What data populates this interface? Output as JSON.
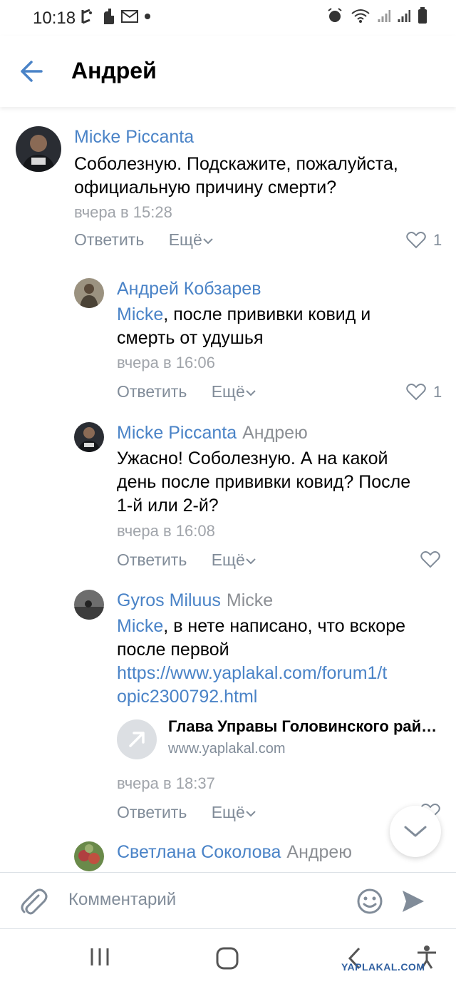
{
  "status_bar": {
    "time": "10:18"
  },
  "header": {
    "title": "Андрей"
  },
  "comments": [
    {
      "author": "Micke Piccanta",
      "reply_to": "",
      "mention": "",
      "text": "Соболезную. Подскажите, пожалуйста, официальную причину смерти?",
      "time": "вчера в 15:28",
      "reply_label": "Ответить",
      "more_label": "Ещё",
      "likes": "1"
    },
    {
      "author": "Андрей Кобзарев",
      "reply_to": "",
      "mention": "Micke",
      "text": ", после прививки ковид и смерть от удушья",
      "time": "вчера в 16:06",
      "reply_label": "Ответить",
      "more_label": "Ещё",
      "likes": "1"
    },
    {
      "author": "Micke Piccanta",
      "reply_to": "Андрею",
      "mention": "",
      "text": "Ужасно! Соболезную. А на какой день после прививки ковид? После 1-й или 2-й?",
      "time": "вчера в 16:08",
      "reply_label": "Ответить",
      "more_label": "Ещё",
      "likes": ""
    },
    {
      "author": "Gyros Miluus",
      "reply_to": "Micke",
      "mention": "Micke",
      "text": ", в нете написано, что вскоре после первой",
      "link": "https://www.yaplakal.com/forum1/topic2300792.html",
      "link_line1": "https://www.yaplakal.com/forum1/t",
      "link_line2": "opic2300792.html",
      "card_title": "Глава Управы Головинского района",
      "card_domain": "www.yaplakal.com",
      "time": "вчера в 18:37",
      "reply_label": "Ответить",
      "more_label": "Ещё",
      "likes": ""
    },
    {
      "author": "Светлана Соколова",
      "reply_to": "Андрею"
    }
  ],
  "composer": {
    "placeholder": "Комментарий"
  },
  "watermark": "YAPLAKAL.COM",
  "colors": {
    "accent": "#4a83c7",
    "secondary": "#818c99",
    "time": "#a0a4aa"
  }
}
